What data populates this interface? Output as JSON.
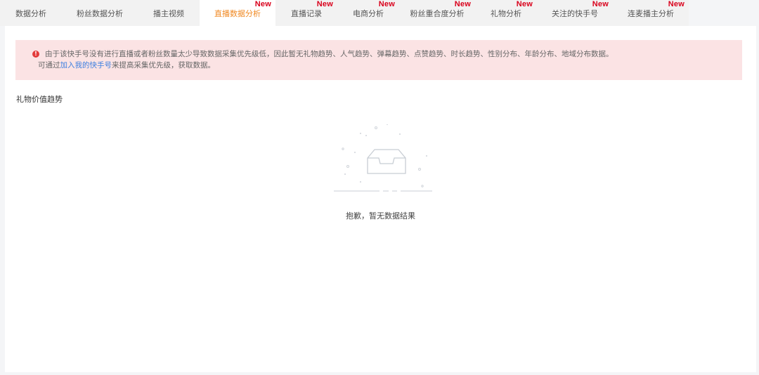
{
  "tabs": [
    {
      "label": "数据分析",
      "badge": ""
    },
    {
      "label": "粉丝数据分析",
      "badge": ""
    },
    {
      "label": "播主视频",
      "badge": ""
    },
    {
      "label": "直播数据分析",
      "badge": "New",
      "active": true
    },
    {
      "label": "直播记录",
      "badge": "New"
    },
    {
      "label": "电商分析",
      "badge": "New"
    },
    {
      "label": "粉丝重合度分析",
      "badge": "New"
    },
    {
      "label": "礼物分析",
      "badge": "New"
    },
    {
      "label": "关注的快手号",
      "badge": "New"
    },
    {
      "label": "连麦播主分析",
      "badge": "New"
    }
  ],
  "alert": {
    "line1": "由于该快手号没有进行直播或者粉丝数量太少导致数据采集优先级低，因此暂无礼物趋势、人气趋势、弹幕趋势、点赞趋势、时长趋势、性别分布、年龄分布、地域分布数据。",
    "line2_prefix": "可通过",
    "line2_link": "加入我的快手号",
    "line2_suffix": "来提高采集优先级，获取数据。"
  },
  "section": {
    "title": "礼物价值趋势"
  },
  "empty": {
    "text": "抱歉，暂无数据结果"
  }
}
